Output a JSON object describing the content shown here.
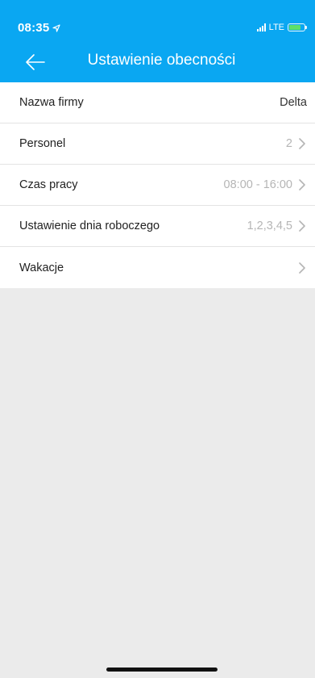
{
  "status_bar": {
    "time": "08:35",
    "network": "LTE",
    "location_icon": "location-arrow-icon",
    "signal_icon": "signal-bars-icon",
    "battery_icon": "battery-charging-icon",
    "battery_level": 0.75,
    "battery_color": "#5de06a"
  },
  "header": {
    "title": "Ustawienie obecności",
    "back_icon": "back-arrow-icon",
    "background": "#0aa7f2"
  },
  "settings": [
    {
      "label": "Nazwa firmy",
      "value": "Delta",
      "chevron": false
    },
    {
      "label": "Personel",
      "value": "2",
      "chevron": true
    },
    {
      "label": "Czas pracy",
      "value": "08:00 - 16:00",
      "chevron": true
    },
    {
      "label": "Ustawienie dnia roboczego",
      "value": "1,2,3,4,5",
      "chevron": true
    },
    {
      "label": "Wakacje",
      "value": "",
      "chevron": true
    }
  ]
}
